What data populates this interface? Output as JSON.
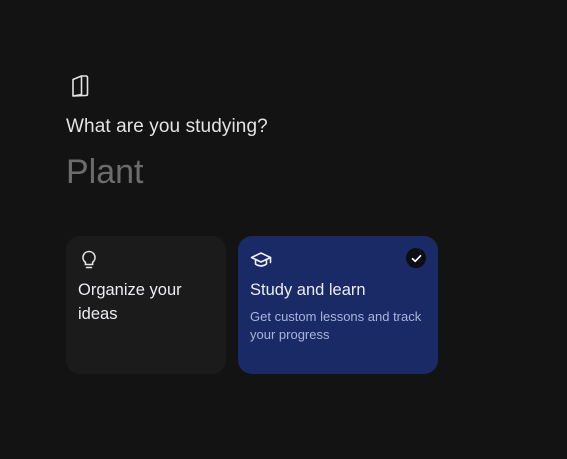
{
  "header": {
    "icon": "notebook-icon",
    "prompt": "What are you studying?"
  },
  "topic_input": {
    "value": "",
    "placeholder": "Plant"
  },
  "options": [
    {
      "icon": "lightbulb-icon",
      "title": "Organize your ideas",
      "description": "",
      "selected": false
    },
    {
      "icon": "graduation-cap-icon",
      "title": "Study and learn",
      "description": "Get custom lessons and track your progress",
      "selected": true,
      "selected_icon": "check-icon"
    }
  ],
  "colors": {
    "background": "#131314",
    "card": "#1b1b1b",
    "selected_card": "#1a2a66",
    "text": "#e3e3e3",
    "placeholder": "#6c6c6c"
  }
}
